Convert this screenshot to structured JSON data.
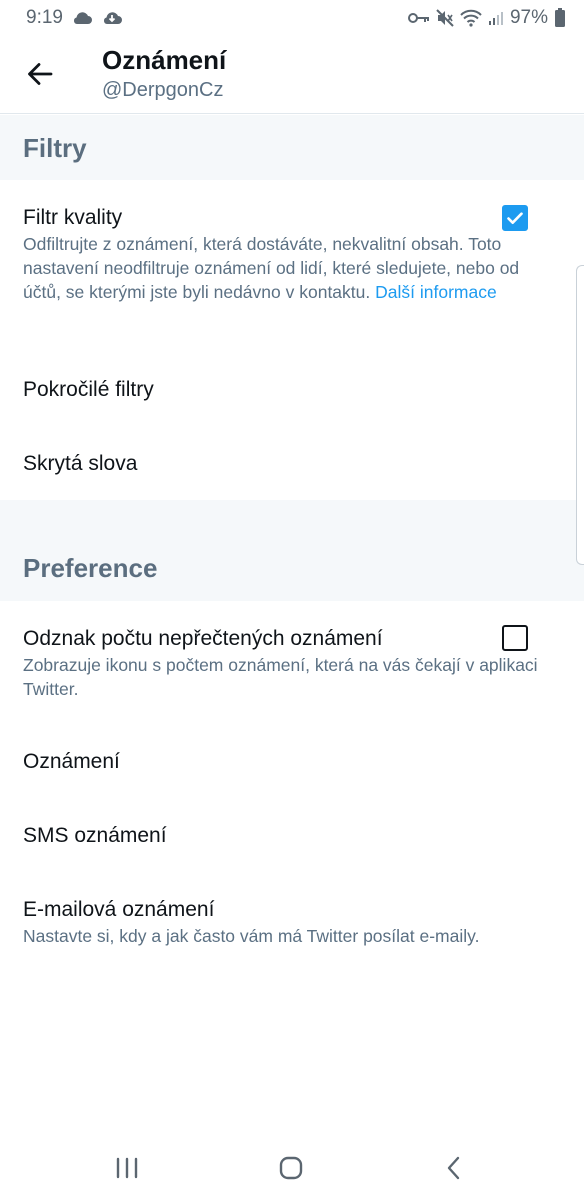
{
  "status_bar": {
    "time": "9:19",
    "battery_percent": "97%",
    "icons": [
      "cloud-icon",
      "cloud-sync-icon",
      "key-icon",
      "mute-icon",
      "wifi-icon",
      "signal-icon",
      "battery-icon"
    ]
  },
  "header": {
    "title": "Oznámení",
    "subtitle": "@DerpgonCz"
  },
  "sections": {
    "filters": {
      "label": "Filtry",
      "quality_filter": {
        "title": "Filtr kvality",
        "checked": true,
        "description": "Odfiltrujte z oznámení, která dostáváte, nekvalitní obsah. Toto nastavení neodfiltruje oznámení od lidí, které sledujete, nebo od účtů, se kterými jste byli nedávno v kontaktu.",
        "link": "Další informace"
      },
      "advanced_filters": "Pokročilé filtry",
      "muted_words": "Skrytá slova"
    },
    "preferences": {
      "label": "Preference",
      "unread_badge": {
        "title": "Odznak počtu nepřečtených oznámení",
        "checked": false,
        "description": "Zobrazuje ikonu s počtem oznámení, která na vás čekají v aplikaci Twitter."
      },
      "push_notifications": "Oznámení",
      "sms_notifications": "SMS oznámení",
      "email_notifications": {
        "title": "E-mailová oznámení",
        "description": "Nastavte si, kdy a jak často vám má Twitter posílat e-maily."
      }
    }
  },
  "colors": {
    "accent": "#1d9bf0",
    "section_bg": "#f5f8fa",
    "secondary_text": "#5b7083"
  }
}
